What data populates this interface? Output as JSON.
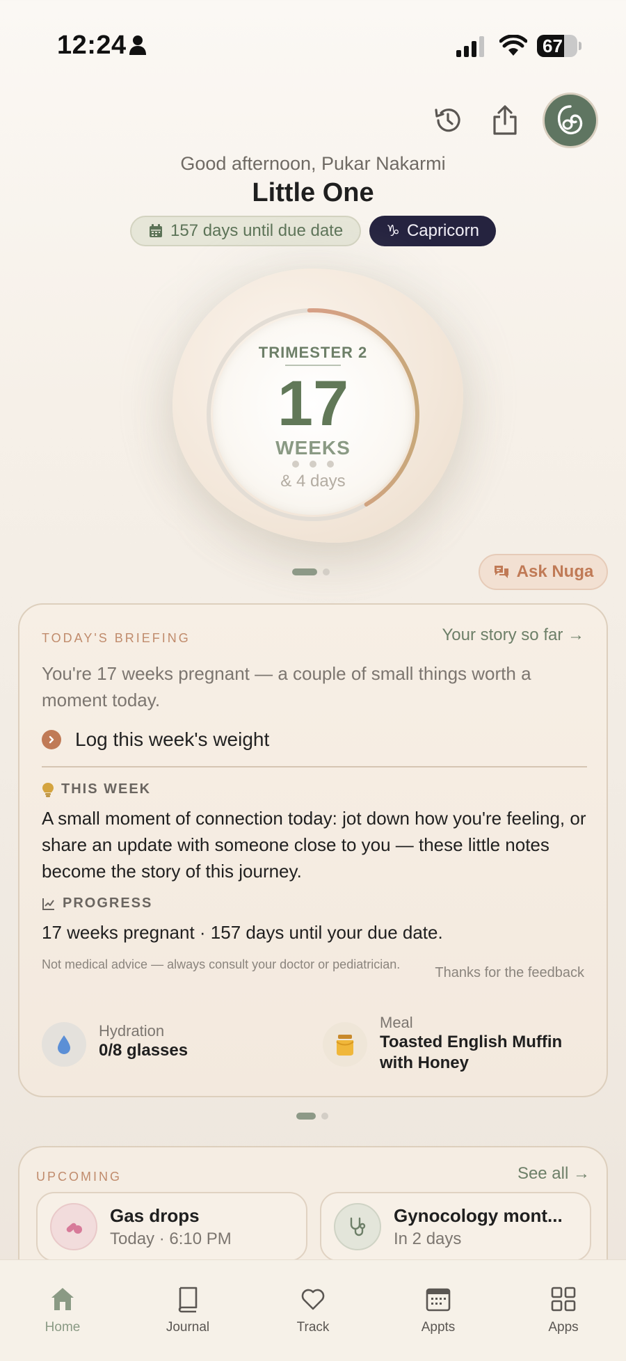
{
  "status_bar": {
    "time": "12:24",
    "battery": "67",
    "battery_level": 0.67
  },
  "greeting": "Good afternoon, Pukar Nakarmi",
  "baby_name": "Little One",
  "due_pill": "157 days until due date",
  "zodiac_pill": "Capricorn",
  "progress_ring": {
    "trimester": "TRIMESTER 2",
    "weeks": "17",
    "weeks_label": "WEEKS",
    "days": "& 4 days",
    "fraction": 0.42
  },
  "ask_button": "Ask Nuga",
  "briefing": {
    "heading": "TODAY'S BRIEFING",
    "story_link": "Your story so far →",
    "summary": "You're 17 weeks pregnant — a couple of small things worth a moment today.",
    "task": "Log this week's weight",
    "this_week_heading": "THIS WEEK",
    "this_week_text": "A small moment of connection today: jot down how you're feeling, or share an update with someone close to you — these little notes become the story of this journey.",
    "progress_heading": "PROGRESS",
    "progress_text": "17 weeks pregnant · 157 days until your due date.",
    "disclaimer": "Not medical advice — always consult your doctor or pediatrician.",
    "feedback": "Thanks for the feedback",
    "hydration_label": "Hydration",
    "hydration_value": "0/8 glasses",
    "meal_label": "Meal",
    "meal_value": "Toasted English Muffin with Honey"
  },
  "upcoming": {
    "heading": "UPCOMING",
    "see_all": "See all →",
    "items": [
      {
        "title": "Gas drops",
        "subtitle": "Today · 6:10 PM",
        "icon": "pill-icon"
      },
      {
        "title": "Gynocology mont...",
        "subtitle": "In 2 days",
        "icon": "stethoscope-icon"
      }
    ]
  },
  "tabs": [
    {
      "label": "Home",
      "icon": "home-icon"
    },
    {
      "label": "Journal",
      "icon": "book-icon"
    },
    {
      "label": "Track",
      "icon": "heart-icon"
    },
    {
      "label": "Appts",
      "icon": "calendar-icon"
    },
    {
      "label": "Apps",
      "icon": "grid-icon"
    }
  ],
  "colors": {
    "accent_green": "#617858",
    "accent_terracotta": "#c07a56",
    "zodiac_pill": "#25233f"
  }
}
